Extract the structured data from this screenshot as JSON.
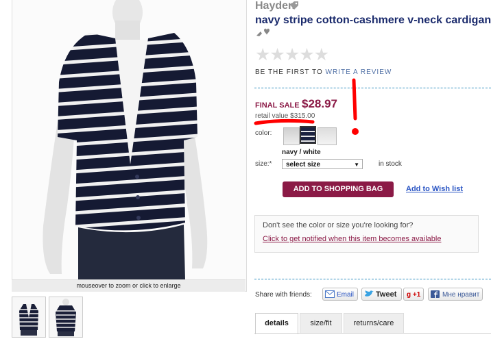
{
  "product": {
    "brand": "Hayden",
    "title": "navy stripe cotton-cashmere v-neck cardigan",
    "image_caption": "mouseover to zoom or click to enlarge"
  },
  "reviews": {
    "stars": "★★★★★",
    "prefix": "BE THE FIRST TO ",
    "link": "WRITE A REVIEW"
  },
  "pricing": {
    "final_sale_label": "FINAL SALE",
    "price": "$28.97",
    "retail": "retail value $315.00"
  },
  "options": {
    "color_label": "color:",
    "selected_color": "navy / white",
    "size_label": "size:*",
    "size_select": "select size",
    "stock": "in stock"
  },
  "actions": {
    "add_to_bag": "ADD TO SHOPPING BAG",
    "wishlist": "Add to Wish list"
  },
  "notify": {
    "question": "Don't see the color or size you're looking for?",
    "link": "Click to get notified when this item becomes available"
  },
  "share": {
    "label": "Share with friends:",
    "email": "Email",
    "tweet": "Tweet",
    "gplus": "+1",
    "facebook": "Мне нравит"
  },
  "tabs": [
    "details",
    "size/fit",
    "returns/care"
  ],
  "colors": {
    "accent": "#8b1a46",
    "title": "#1a2a6c",
    "link": "#2a55c4",
    "annotation": "#ff0000"
  },
  "icons": [
    "tag-icon",
    "recommend-icon",
    "email-icon",
    "twitter-icon",
    "facebook-icon"
  ]
}
